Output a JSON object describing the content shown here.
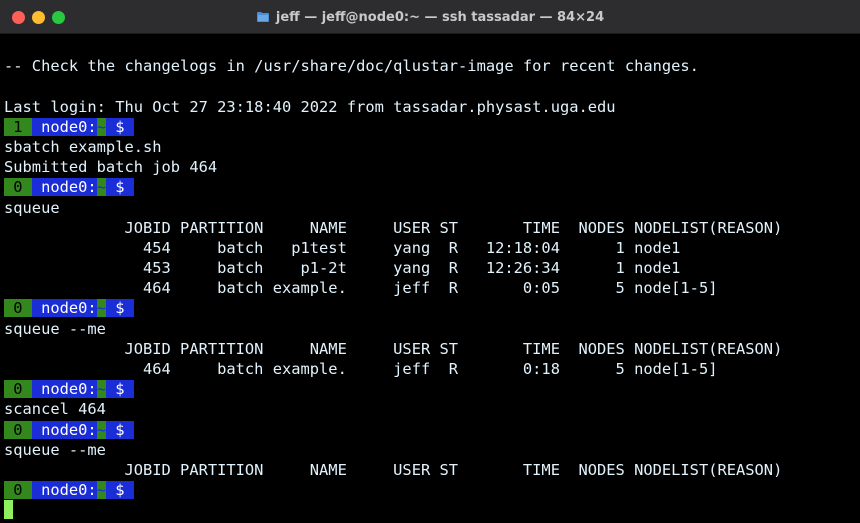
{
  "window": {
    "title": "jeff — jeff@node0:~ — ssh tassadar — 84×24",
    "traffic_colors": {
      "close": "#fe5f57",
      "minimize": "#febc2e",
      "maximize": "#28c840"
    }
  },
  "terminal": {
    "background": "#000000",
    "foreground": "#e2f2fc",
    "cursor_color": "#8ef05c",
    "lines": [
      {
        "type": "text",
        "text": ""
      },
      {
        "type": "text",
        "text": "-- Check the changelogs in /usr/share/doc/qlustar-image for recent changes."
      },
      {
        "type": "text",
        "text": ""
      },
      {
        "type": "text",
        "text": "Last login: Thu Oct 27 23:18:40 2022 from tassadar.physast.uga.edu"
      },
      {
        "type": "prompt",
        "num": " 1 ",
        "host": " node0:",
        "tilde": "~",
        "dollar": " $ "
      },
      {
        "type": "text",
        "text": "sbatch example.sh"
      },
      {
        "type": "text",
        "text": "Submitted batch job 464"
      },
      {
        "type": "prompt",
        "num": " 0 ",
        "host": " node0:",
        "tilde": "~",
        "dollar": " $ "
      },
      {
        "type": "text",
        "text": "squeue"
      },
      {
        "type": "text",
        "text": "             JOBID PARTITION     NAME     USER ST       TIME  NODES NODELIST(REASON)"
      },
      {
        "type": "text",
        "text": "               454     batch   p1test     yang  R   12:18:04      1 node1"
      },
      {
        "type": "text",
        "text": "               453     batch    p1-2t     yang  R   12:26:34      1 node1"
      },
      {
        "type": "text",
        "text": "               464     batch example.     jeff  R       0:05      5 node[1-5]"
      },
      {
        "type": "prompt",
        "num": " 0 ",
        "host": " node0:",
        "tilde": "~",
        "dollar": " $ "
      },
      {
        "type": "text",
        "text": "squeue --me"
      },
      {
        "type": "text",
        "text": "             JOBID PARTITION     NAME     USER ST       TIME  NODES NODELIST(REASON)"
      },
      {
        "type": "text",
        "text": "               464     batch example.     jeff  R       0:18      5 node[1-5]"
      },
      {
        "type": "prompt",
        "num": " 0 ",
        "host": " node0:",
        "tilde": "~",
        "dollar": " $ "
      },
      {
        "type": "text",
        "text": "scancel 464"
      },
      {
        "type": "prompt",
        "num": " 0 ",
        "host": " node0:",
        "tilde": "~",
        "dollar": " $ "
      },
      {
        "type": "text",
        "text": "squeue --me"
      },
      {
        "type": "text",
        "text": "             JOBID PARTITION     NAME     USER ST       TIME  NODES NODELIST(REASON)"
      },
      {
        "type": "prompt",
        "num": " 0 ",
        "host": " node0:",
        "tilde": "~",
        "dollar": " $ "
      },
      {
        "type": "cursor"
      }
    ]
  }
}
